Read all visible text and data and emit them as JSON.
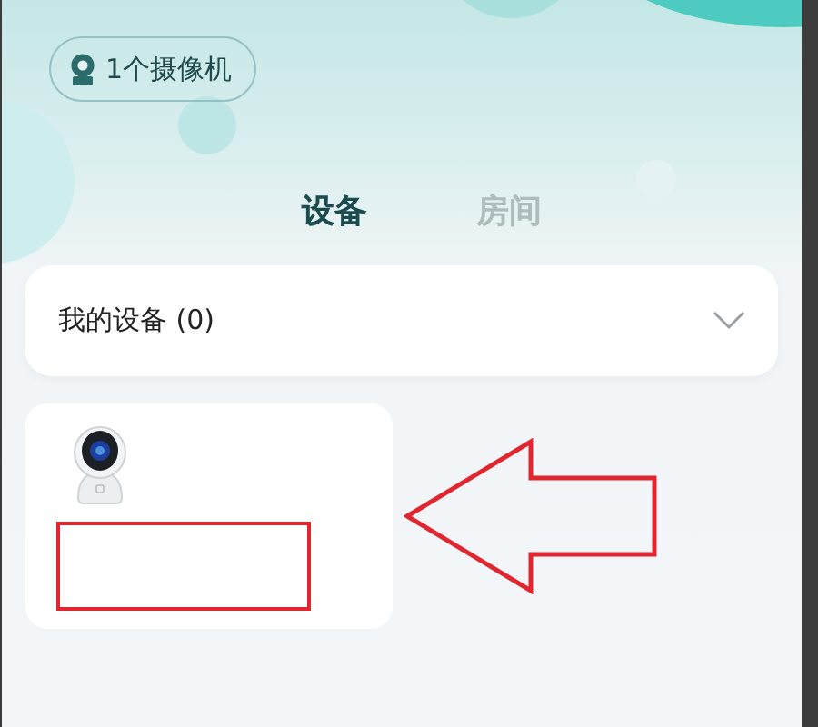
{
  "camera_badge": {
    "label": "1个摄像机"
  },
  "tabs": [
    {
      "label": "设备",
      "selected": true
    },
    {
      "label": "房间",
      "selected": false
    }
  ],
  "device_group": {
    "label": "我的设备 (0)",
    "expanded": false
  },
  "device_card": {
    "highlighted": true
  },
  "annotations": [
    {
      "kind": "arrow"
    }
  ]
}
